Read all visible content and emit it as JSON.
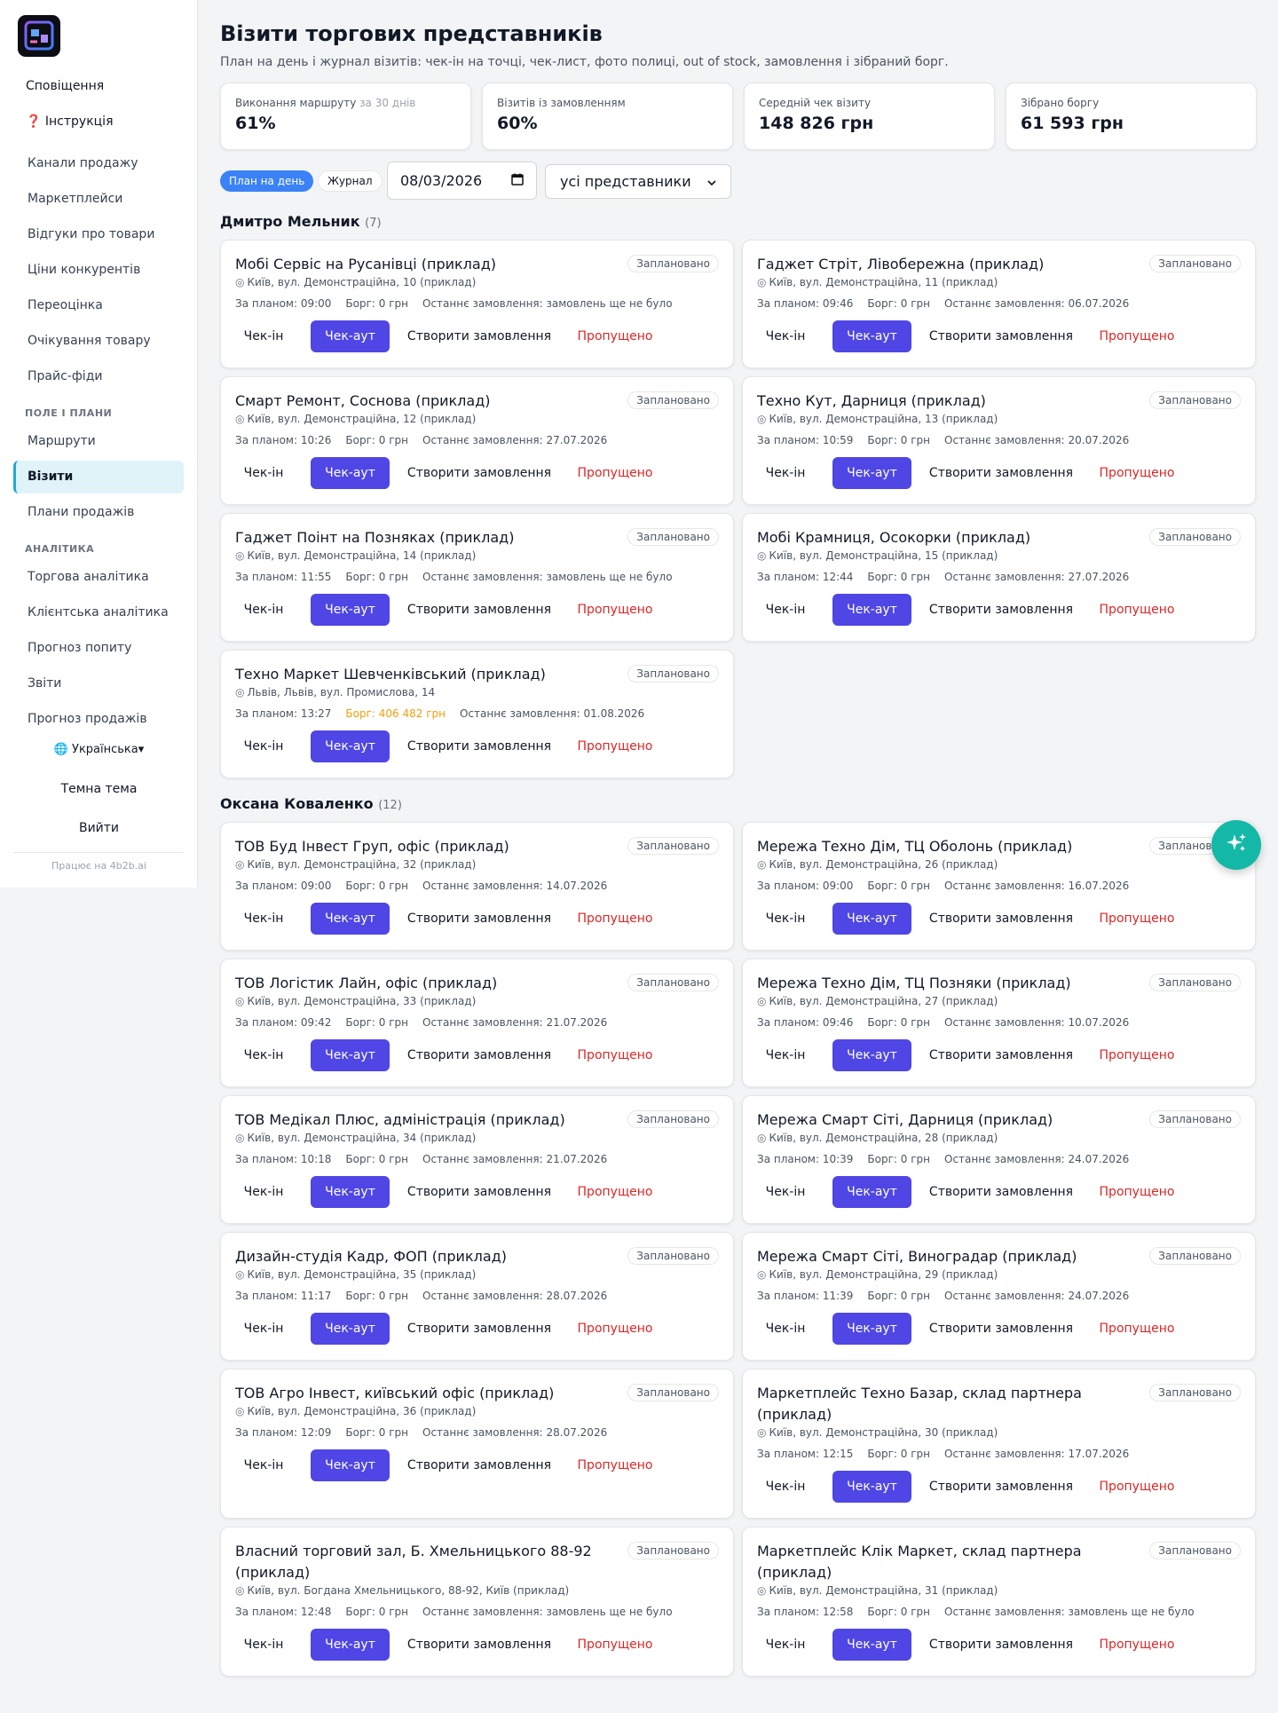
{
  "sidebar": {
    "notifications": "Сповіщення",
    "help": "❓ Інструкція",
    "links": [
      "Канали продажу",
      "Маркетплейси",
      "Відгуки про товари",
      "Ціни конкурентів",
      "Переоцінка",
      "Очікування товару",
      "Прайс-фіди"
    ],
    "section_field": "ПОЛЕ І ПЛАНИ",
    "field_links": [
      "Маршрути",
      "Візити",
      "Плани продажів"
    ],
    "section_analytics": "АНАЛІТИКА",
    "analytics_links": [
      "Торгова аналітика",
      "Клієнтська аналітика",
      "Прогноз попиту",
      "Звіти",
      "Прогноз продажів"
    ],
    "language": "🌐 Українська▾",
    "theme": "Темна тема",
    "logout": "Вийти",
    "footer": "Працює на 4b2b.ai"
  },
  "header": {
    "title": "Візити торгових представників",
    "subtitle": "План на день і журнал візитів: чек-ін на точці, чек-лист, фото полиці, out of stock, замовлення і зібраний борг."
  },
  "kpis": [
    {
      "label": "Виконання маршруту",
      "suffix": " за 30 днів",
      "value": "61%"
    },
    {
      "label": "Візитів із замовленням",
      "suffix": "",
      "value": "60%"
    },
    {
      "label": "Середній чек візиту",
      "suffix": "",
      "value": "148 826 грн"
    },
    {
      "label": "Зібрано боргу",
      "suffix": "",
      "value": "61 593 грн"
    }
  ],
  "filters": {
    "plan_tab": "План на день",
    "journal_tab": "Журнал",
    "date": "08/03/2026",
    "rep_select": "усі представники"
  },
  "labels": {
    "checkin": "Чек-ін",
    "checkout": "Чек-аут",
    "create_order": "Створити замовлення",
    "skipped": "Пропущено",
    "status": "Заплановано",
    "pin": "◎"
  },
  "groups": [
    {
      "name": "Дмитро Мельник",
      "count": "(7)",
      "visits": [
        {
          "title": "Мобі Сервіс на Русанівці (приклад)",
          "address": "Київ, вул. Демонстраційна, 10 (приклад)",
          "plan": "За планом: 09:00",
          "debt": "Борг: 0 грн",
          "last": "Останнє замовлення: замовлень ще не було"
        },
        {
          "title": "Гаджет Стріт, Лівобережна (приклад)",
          "address": "Київ, вул. Демонстраційна, 11 (приклад)",
          "plan": "За планом: 09:46",
          "debt": "Борг: 0 грн",
          "last": "Останнє замовлення: 06.07.2026"
        },
        {
          "title": "Смарт Ремонт, Соснова (приклад)",
          "address": "Київ, вул. Демонстраційна, 12 (приклад)",
          "plan": "За планом: 10:26",
          "debt": "Борг: 0 грн",
          "last": "Останнє замовлення: 27.07.2026"
        },
        {
          "title": "Техно Кут, Дарниця (приклад)",
          "address": "Київ, вул. Демонстраційна, 13 (приклад)",
          "plan": "За планом: 10:59",
          "debt": "Борг: 0 грн",
          "last": "Останнє замовлення: 20.07.2026"
        },
        {
          "title": "Гаджет Поінт на Позняках (приклад)",
          "address": "Київ, вул. Демонстраційна, 14 (приклад)",
          "plan": "За планом: 11:55",
          "debt": "Борг: 0 грн",
          "last": "Останнє замовлення: замовлень ще не було"
        },
        {
          "title": "Мобі Крамниця, Осокорки (приклад)",
          "address": "Київ, вул. Демонстраційна, 15 (приклад)",
          "plan": "За планом: 12:44",
          "debt": "Борг: 0 грн",
          "last": "Останнє замовлення: 27.07.2026"
        },
        {
          "title": "Техно Маркет Шевченківський (приклад)",
          "address": "Львів, Львів, вул. Промислова, 14",
          "plan": "За планом: 13:27",
          "debt": "Борг: 406 482 грн",
          "last": "Останнє замовлення: 01.08.2026"
        }
      ]
    },
    {
      "name": "Оксана Коваленко",
      "count": "(12)",
      "visits": [
        {
          "title": "ТОВ Буд Інвест Груп, офіс (приклад)",
          "address": "Київ, вул. Демонстраційна, 32 (приклад)",
          "plan": "За планом: 09:00",
          "debt": "Борг: 0 грн",
          "last": "Останнє замовлення: 14.07.2026"
        },
        {
          "title": "Мережа Техно Дім, ТЦ Оболонь (приклад)",
          "address": "Київ, вул. Демонстраційна, 26 (приклад)",
          "plan": "За планом: 09:00",
          "debt": "Борг: 0 грн",
          "last": "Останнє замовлення: 16.07.2026"
        },
        {
          "title": "ТОВ Логістик Лайн, офіс (приклад)",
          "address": "Київ, вул. Демонстраційна, 33 (приклад)",
          "plan": "За планом: 09:42",
          "debt": "Борг: 0 грн",
          "last": "Останнє замовлення: 21.07.2026"
        },
        {
          "title": "Мережа Техно Дім, ТЦ Позняки (приклад)",
          "address": "Київ, вул. Демонстраційна, 27 (приклад)",
          "plan": "За планом: 09:46",
          "debt": "Борг: 0 грн",
          "last": "Останнє замовлення: 10.07.2026"
        },
        {
          "title": "ТОВ Медікал Плюс, адміністрація (приклад)",
          "address": "Київ, вул. Демонстраційна, 34 (приклад)",
          "plan": "За планом: 10:18",
          "debt": "Борг: 0 грн",
          "last": "Останнє замовлення: 21.07.2026"
        },
        {
          "title": "Мережа Смарт Сіті, Дарниця (приклад)",
          "address": "Київ, вул. Демонстраційна, 28 (приклад)",
          "plan": "За планом: 10:39",
          "debt": "Борг: 0 грн",
          "last": "Останнє замовлення: 24.07.2026"
        },
        {
          "title": "Дизайн-студія Кадр, ФОП (приклад)",
          "address": "Київ, вул. Демонстраційна, 35 (приклад)",
          "plan": "За планом: 11:17",
          "debt": "Борг: 0 грн",
          "last": "Останнє замовлення: 28.07.2026"
        },
        {
          "title": "Мережа Смарт Сіті, Виноградар (приклад)",
          "address": "Київ, вул. Демонстраційна, 29 (приклад)",
          "plan": "За планом: 11:39",
          "debt": "Борг: 0 грн",
          "last": "Останнє замовлення: 24.07.2026"
        },
        {
          "title": "ТОВ Агро Інвест, київський офіс (приклад)",
          "address": "Київ, вул. Демонстраційна, 36 (приклад)",
          "plan": "За планом: 12:09",
          "debt": "Борг: 0 грн",
          "last": "Останнє замовлення: 28.07.2026"
        },
        {
          "title": "Маркетплейс Техно Базар, склад партнера (приклад)",
          "address": "Київ, вул. Демонстраційна, 30 (приклад)",
          "plan": "За планом: 12:15",
          "debt": "Борг: 0 грн",
          "last": "Останнє замовлення: 17.07.2026"
        },
        {
          "title": "Власний торговий зал, Б. Хмельницького 88-92 (приклад)",
          "address": "Київ, вул. Богдана Хмельницького, 88-92, Київ (приклад)",
          "plan": "За планом: 12:48",
          "debt": "Борг: 0 грн",
          "last": "Останнє замовлення: замовлень ще не було"
        },
        {
          "title": "Маркетплейс Клік Маркет, склад партнера (приклад)",
          "address": "Київ, вул. Демонстраційна, 31 (приклад)",
          "plan": "За планом: 12:58",
          "debt": "Борг: 0 грн",
          "last": "Останнє замовлення: замовлень ще не було"
        }
      ]
    }
  ]
}
